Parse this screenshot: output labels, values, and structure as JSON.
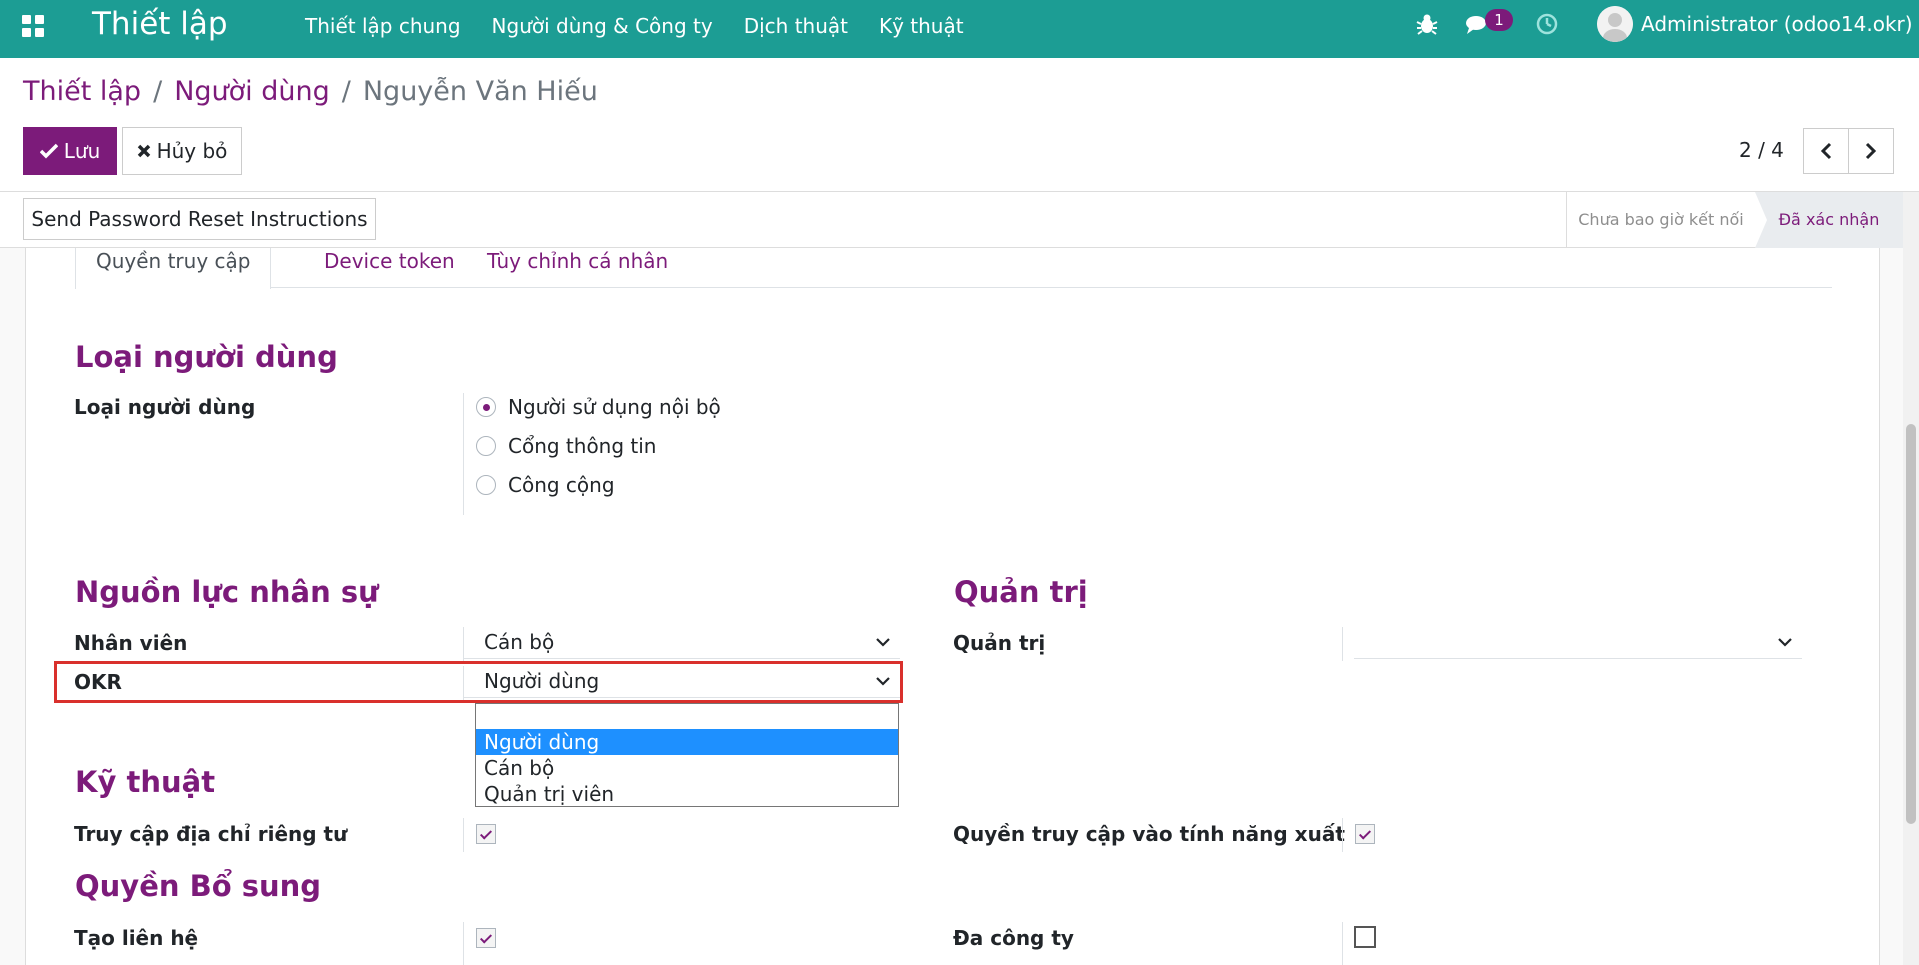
{
  "navbar": {
    "app_title": "Thiết lập",
    "menu": [
      "Thiết lập chung",
      "Người dùng & Công ty",
      "Dịch thuật",
      "Kỹ thuật"
    ],
    "chat_badge": "1",
    "user": "Administrator (odoo14.okr)"
  },
  "breadcrumb": {
    "root": "Thiết lập",
    "parent": "Người dùng",
    "current": "Nguyễn Văn Hiếu",
    "separator": "/"
  },
  "toolbar": {
    "save_label": "Lưu",
    "discard_label": "Hủy bỏ",
    "pager": "2 / 4"
  },
  "statusbar": {
    "reset_button": "Send Password Reset Instructions",
    "stages": [
      "Chưa bao giờ kết nối",
      "Đã xác nhận"
    ],
    "active_stage": "Đã xác nhận"
  },
  "tabs": [
    "Quyền truy cập",
    "Device token",
    "Tùy chỉnh cá nhân"
  ],
  "user_type": {
    "section": "Loại người dùng",
    "label": "Loại người dùng",
    "options": [
      "Người sử dụng nội bộ",
      "Cổng thông tin",
      "Công cộng"
    ],
    "selected": "Người sử dụng nội bộ"
  },
  "hr": {
    "section": "Nguồn lực nhân sự",
    "employee_label": "Nhân viên",
    "employee_value": "Cán bộ",
    "okr_label": "OKR",
    "okr_value": "Người dùng"
  },
  "admin": {
    "section": "Quản trị",
    "label": "Quản trị",
    "value": ""
  },
  "okr_dropdown": {
    "options": [
      "",
      "Người dùng",
      "Cán bộ",
      "Quản trị viên"
    ],
    "highlighted": "Người dùng"
  },
  "technical": {
    "section": "Kỹ thuật",
    "private_address_label": "Truy cập địa chỉ riêng tư",
    "private_address_checked": true,
    "export_label": "Quyền truy cập vào tính năng xuất",
    "export_checked": true
  },
  "extra": {
    "section": "Quyền Bổ sung",
    "create_contact_label": "Tạo liên hệ",
    "create_contact_checked": true,
    "multi_company_label": "Đa công ty",
    "multi_company_checked": false
  },
  "colors": {
    "navbar": "#1c9d94",
    "primary": "#7c1b7a",
    "highlight": "#d9302c",
    "dropdown_selected": "#1e90ff"
  }
}
